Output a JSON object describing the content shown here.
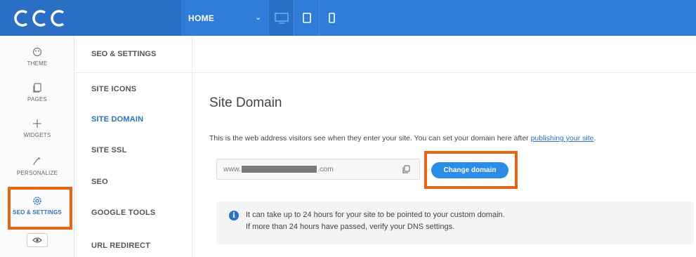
{
  "topbar": {
    "logo_text": "CCC",
    "page_selector": "HOME",
    "devices": [
      {
        "name": "desktop",
        "active": true
      },
      {
        "name": "tablet",
        "active": false
      },
      {
        "name": "mobile",
        "active": false
      }
    ]
  },
  "rail": {
    "items": [
      {
        "label": "THEME",
        "icon": "palette-icon"
      },
      {
        "label": "PAGES",
        "icon": "pages-icon"
      },
      {
        "label": "WIDGETS",
        "icon": "plus-icon"
      },
      {
        "label": "PERSONALIZE",
        "icon": "personalize-icon"
      },
      {
        "label": "SEO & SETTINGS",
        "icon": "gear-icon",
        "active": true
      }
    ]
  },
  "submenu": {
    "header": "SEO & SETTINGS",
    "items": [
      {
        "label": "SITE ICONS"
      },
      {
        "label": "SITE DOMAIN",
        "active": true
      },
      {
        "label": "SITE SSL"
      },
      {
        "label": "SEO"
      },
      {
        "label": "GOOGLE TOOLS"
      },
      {
        "label": "URL REDIRECT"
      }
    ]
  },
  "main": {
    "title": "Site Domain",
    "description": "This is the web address visitors see when they enter your site. You can set your domain here after ",
    "description_link": "publishing your site",
    "description_end": ".",
    "domain_prefix": "www.",
    "domain_suffix": ".com",
    "change_button": "Change domain",
    "notice_line1": "It can take up to 24 hours for your site to be pointed to your custom domain.",
    "notice_line2": "If more than 24 hours have passed, verify your DNS settings."
  },
  "colors": {
    "brand_blue": "#2a6fc4",
    "highlight_orange": "#e8650f"
  }
}
